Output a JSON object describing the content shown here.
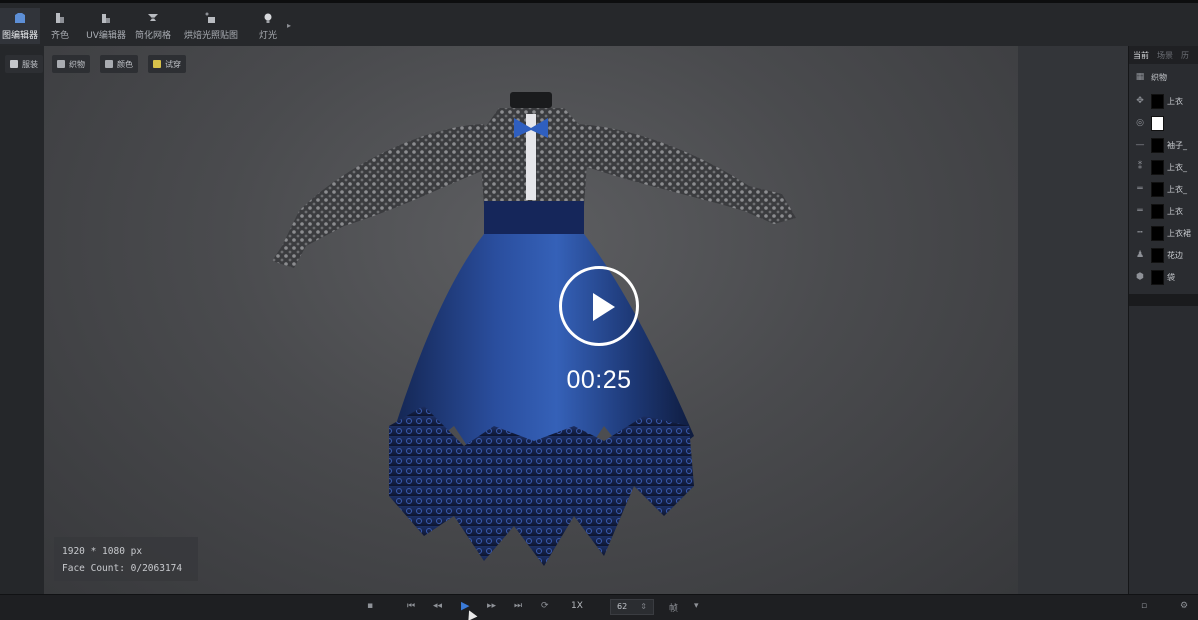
{
  "toolbar": {
    "tools": [
      {
        "label": "图编辑器",
        "icon": "shirt-icon",
        "active": true
      },
      {
        "label": "齐色",
        "icon": "palette-icon",
        "active": false
      },
      {
        "label": "UV编辑器",
        "icon": "uv-grid-icon",
        "active": false
      },
      {
        "label": "简化网格",
        "icon": "mesh-icon",
        "active": false
      },
      {
        "label": "烘焙光照贴图",
        "icon": "bake-icon",
        "active": false
      },
      {
        "label": "灯光",
        "icon": "light-bulb-icon",
        "active": false
      }
    ],
    "more_icon": "expand-icon"
  },
  "viewport": {
    "mini_toolbar": [
      {
        "label": "服装",
        "icon": "garment-icon"
      },
      {
        "label": "织物",
        "icon": "fabric-icon"
      },
      {
        "label": "颜色",
        "icon": "color-icon"
      },
      {
        "label": "试穿",
        "icon": "try-on-icon"
      }
    ],
    "right_icons": [
      "camera-icon",
      "magic-wand-icon",
      "fullscreen-icon"
    ],
    "info": {
      "resolution": "1920 * 1080 px",
      "face_count": "Face Count: 0/2063174"
    }
  },
  "video_overlay": {
    "time": "00:25",
    "icon": "play-icon"
  },
  "side_panel": {
    "tabs": [
      "当前",
      "场景",
      "历"
    ],
    "header_label": "织物",
    "rows": [
      {
        "icon": "move-icon",
        "label": "上衣",
        "swatch": "#000000"
      },
      {
        "icon": "target-icon",
        "label": "",
        "swatch": "#ffffff"
      },
      {
        "icon": "line-icon",
        "label": "袖子_",
        "swatch": "#000000"
      },
      {
        "icon": "pin-icon",
        "label": "上衣_",
        "swatch": "#000000"
      },
      {
        "icon": "double-line-icon",
        "label": "上衣_",
        "swatch": "#000000"
      },
      {
        "icon": "double-line-icon",
        "label": "上衣",
        "swatch": "#000000"
      },
      {
        "icon": "stitch-icon",
        "label": "上衣裙",
        "swatch": "#000000"
      },
      {
        "icon": "avatar-icon",
        "label": "花边",
        "swatch": "#000000"
      },
      {
        "icon": "package-icon",
        "label": "袋",
        "swatch": "#000000"
      }
    ]
  },
  "timeline": {
    "speed": "1X",
    "frame": "62",
    "unit": "帧",
    "play_color": "#3b7bd9"
  },
  "colors": {
    "accent": "#3b7bd9",
    "dress_blue": "#1e3a7a",
    "viewport_bg": "#4a4b4e"
  }
}
